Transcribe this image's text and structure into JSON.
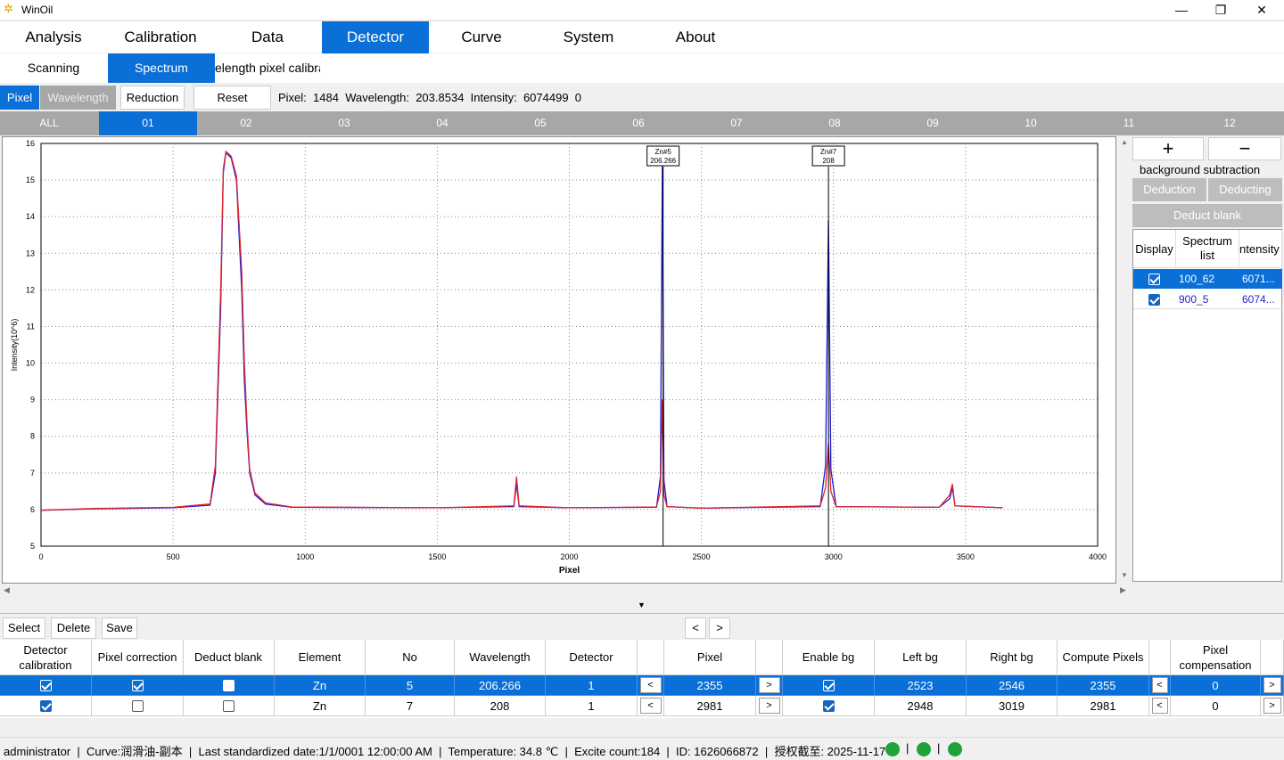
{
  "window": {
    "title": "WinOil",
    "minimize": "—",
    "maximize": "❐",
    "close": "✕"
  },
  "main_menu": [
    "Analysis",
    "Calibration",
    "Data",
    "Detector",
    "Curve",
    "System",
    "About"
  ],
  "main_menu_active": "Detector",
  "sub_menu": [
    "Scanning",
    "Spectrum",
    "elength pixel calibra"
  ],
  "sub_menu_active": "Spectrum",
  "toolbar": {
    "pixel": "Pixel",
    "wavelength": "Wavelength",
    "reduction": "Reduction",
    "reset": "Reset",
    "pixel_label": "Pixel:",
    "pixel_value": "1484",
    "wavelength_label": "Wavelength:",
    "wavelength_value": "203.8534",
    "intensity_label": "Intensity:",
    "intensity_value": "6074499",
    "extra_value": "0"
  },
  "detector_tabs": [
    "ALL",
    "01",
    "02",
    "03",
    "04",
    "05",
    "06",
    "07",
    "08",
    "09",
    "10",
    "11",
    "12"
  ],
  "detector_tab_active": "01",
  "chart_data": {
    "type": "line",
    "xlabel": "Pixel",
    "ylabel": "Intensity(10^6)",
    "xlim": [
      0,
      4000
    ],
    "ylim": [
      5,
      16
    ],
    "x_ticks": [
      "0",
      "500",
      "1000",
      "1500",
      "2000",
      "2500",
      "3000",
      "3500",
      "4000"
    ],
    "y_ticks": [
      "5",
      "6",
      "7",
      "8",
      "9",
      "10",
      "11",
      "12",
      "13",
      "14",
      "15",
      "16"
    ],
    "grid": true,
    "series": [
      {
        "name": "100_62",
        "color": "#1a1ad6",
        "points": [
          [
            0,
            5.98
          ],
          [
            200,
            6.02
          ],
          [
            500,
            6.05
          ],
          [
            640,
            6.12
          ],
          [
            660,
            7.0
          ],
          [
            680,
            11.5
          ],
          [
            690,
            15.2
          ],
          [
            700,
            15.75
          ],
          [
            720,
            15.6
          ],
          [
            740,
            15.0
          ],
          [
            760,
            12.0
          ],
          [
            770,
            9.5
          ],
          [
            780,
            8.1
          ],
          [
            790,
            7.0
          ],
          [
            810,
            6.4
          ],
          [
            850,
            6.15
          ],
          [
            950,
            6.06
          ],
          [
            1500,
            6.05
          ],
          [
            1790,
            6.08
          ],
          [
            1800,
            6.7
          ],
          [
            1810,
            6.08
          ],
          [
            2000,
            6.05
          ],
          [
            2330,
            6.06
          ],
          [
            2345,
            6.9
          ],
          [
            2352,
            15.4
          ],
          [
            2358,
            6.8
          ],
          [
            2370,
            6.08
          ],
          [
            2500,
            6.04
          ],
          [
            2950,
            6.08
          ],
          [
            2970,
            7.2
          ],
          [
            2981,
            13.9
          ],
          [
            2990,
            7.1
          ],
          [
            3010,
            6.08
          ],
          [
            3400,
            6.06
          ],
          [
            3440,
            6.3
          ],
          [
            3450,
            6.6
          ],
          [
            3460,
            6.1
          ],
          [
            3640,
            6.05
          ]
        ]
      },
      {
        "name": "900_5",
        "color": "#e0242c",
        "points": [
          [
            0,
            5.98
          ],
          [
            200,
            6.03
          ],
          [
            500,
            6.06
          ],
          [
            640,
            6.15
          ],
          [
            660,
            7.2
          ],
          [
            680,
            12.0
          ],
          [
            690,
            15.3
          ],
          [
            700,
            15.78
          ],
          [
            720,
            15.65
          ],
          [
            740,
            15.1
          ],
          [
            760,
            12.5
          ],
          [
            770,
            10.0
          ],
          [
            780,
            8.3
          ],
          [
            790,
            7.1
          ],
          [
            810,
            6.45
          ],
          [
            850,
            6.18
          ],
          [
            950,
            6.07
          ],
          [
            1500,
            6.05
          ],
          [
            1790,
            6.1
          ],
          [
            1800,
            6.9
          ],
          [
            1810,
            6.1
          ],
          [
            2000,
            6.05
          ],
          [
            2330,
            6.07
          ],
          [
            2345,
            6.5
          ],
          [
            2352,
            9.0
          ],
          [
            2358,
            6.4
          ],
          [
            2370,
            6.08
          ],
          [
            2500,
            6.04
          ],
          [
            2950,
            6.1
          ],
          [
            2970,
            6.6
          ],
          [
            2981,
            7.8
          ],
          [
            2990,
            6.5
          ],
          [
            3010,
            6.08
          ],
          [
            3400,
            6.06
          ],
          [
            3440,
            6.4
          ],
          [
            3450,
            6.7
          ],
          [
            3460,
            6.1
          ],
          [
            3640,
            6.05
          ]
        ]
      }
    ],
    "markers": [
      {
        "x": 2355,
        "label1": "Zn#5",
        "label2": "206.266"
      },
      {
        "x": 2981,
        "label1": "Zn#7",
        "label2": "208"
      }
    ]
  },
  "right_panel": {
    "plus": "+",
    "minus": "−",
    "caption": "background subtraction",
    "deduction": "Deduction",
    "deducting": "Deducting",
    "deduct_blank": "Deduct blank",
    "headers": [
      "Display",
      "Spectrum list",
      "ntensity"
    ],
    "rows": [
      {
        "display": true,
        "name": "100_62",
        "intensity": "6071...",
        "selected": true
      },
      {
        "display": true,
        "name": "900_5",
        "intensity": "6074...",
        "selected": false
      }
    ]
  },
  "bottom_bar": {
    "select": "Select",
    "delete": "Delete",
    "save": "Save",
    "prev": "<",
    "next": ">"
  },
  "grid": {
    "headers": [
      "Detector calibration",
      "Pixel correction",
      "Deduct blank",
      "Element",
      "No",
      "Wavelength",
      "Detector",
      "",
      "Pixel",
      "",
      "Enable bg",
      "Left bg",
      "Right bg",
      "Compute Pixels",
      "",
      "Pixel compensation",
      ""
    ],
    "rows": [
      {
        "det_cal": true,
        "pix_corr": true,
        "deduct": false,
        "element": "Zn",
        "no": "5",
        "wavelength": "206.266",
        "detector": "1",
        "pixel": "2355",
        "enable_bg": true,
        "left_bg": "2523",
        "right_bg": "2546",
        "compute": "2355",
        "comp": "0",
        "selected": true
      },
      {
        "det_cal": true,
        "pix_corr": false,
        "deduct": false,
        "element": "Zn",
        "no": "7",
        "wavelength": "208",
        "detector": "1",
        "pixel": "2981",
        "enable_bg": true,
        "left_bg": "2948",
        "right_bg": "3019",
        "compute": "2981",
        "comp": "0",
        "selected": false
      }
    ],
    "lt": "<",
    "gt": ">"
  },
  "status": {
    "user": "administrator",
    "curve": "Curve:润滑油-副本",
    "standardized": "Last standardized date:1/1/0001 12:00:00 AM",
    "temperature": "Temperature: 34.8 ℃",
    "excite": "Excite count:184",
    "id": "ID: 1626066872",
    "license": "授权截至: 2025-11-17",
    "sep": "|"
  }
}
